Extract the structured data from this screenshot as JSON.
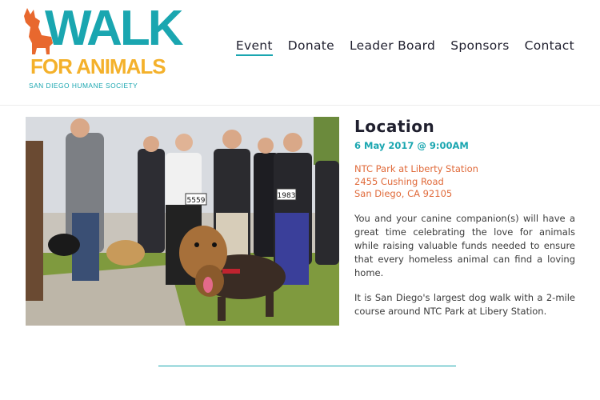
{
  "logo": {
    "walk": "WALK",
    "for_animals": "FOR ANIMALS",
    "subtitle": "SAN DIEGO HUMANE SOCIETY",
    "dog_icon": "dog-silhouette",
    "walk_color": "#1aa6b0",
    "for_animals_color": "#f4b12b",
    "dog_color": "#e8682e"
  },
  "nav": {
    "items": [
      {
        "label": "Event",
        "active": true
      },
      {
        "label": "Donate"
      },
      {
        "label": "Leader Board"
      },
      {
        "label": "Sponsors"
      },
      {
        "label": "Contact"
      }
    ]
  },
  "event": {
    "heading": "Location",
    "date": "6 May 2017 @ 9:00AM",
    "address": [
      "NTC Park at Liberty Station",
      "2455 Cushing Road",
      "San Diego, CA 92105"
    ],
    "paragraphs": [
      "You and your canine companion(s) will have a great time celebrating the love for animals while raising valuable funds needed to ensure that every homeless animal can find a loving home.",
      "It is San Diego's largest dog walk with a 2-mile course around NTC Park at Libery Station."
    ],
    "bib_numbers": [
      "5559",
      "1983"
    ],
    "accent": "#1aa6b0",
    "address_color": "#e06a3a"
  }
}
